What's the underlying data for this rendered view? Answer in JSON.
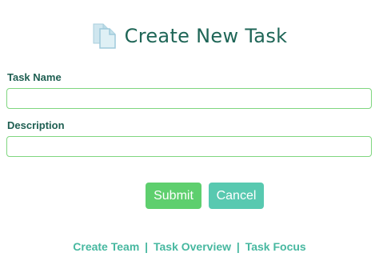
{
  "header": {
    "title": "Create New Task",
    "icon": "documents-icon"
  },
  "form": {
    "task_name": {
      "label": "Task Name",
      "value": "",
      "placeholder": ""
    },
    "description": {
      "label": "Description",
      "value": "",
      "placeholder": ""
    },
    "submit_label": "Submit",
    "cancel_label": "Cancel"
  },
  "footer": {
    "links": [
      "Create Team",
      "Task Overview",
      "Task Focus"
    ],
    "separator": "|"
  },
  "colors": {
    "title": "#1f6657",
    "input_border": "#7fd67f",
    "submit_bg": "#5ecf6e",
    "cancel_bg": "#58c9b0",
    "link": "#47b8a0"
  }
}
